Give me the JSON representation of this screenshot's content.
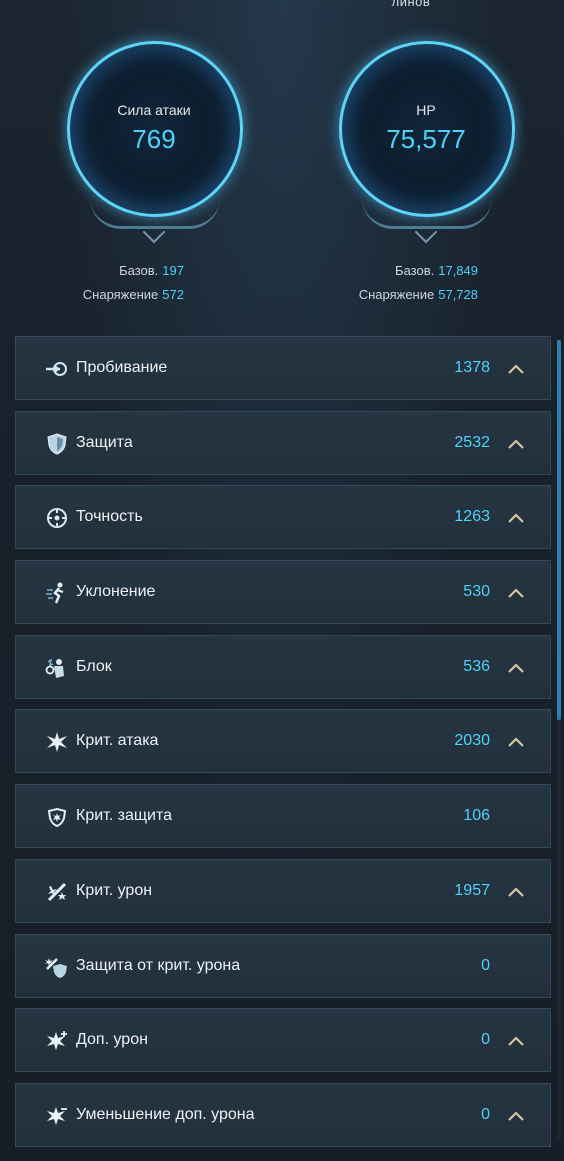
{
  "header": {
    "cut_text": "линов"
  },
  "attack": {
    "label": "Сила атаки",
    "value": "769",
    "base_label": "Базов.",
    "base_value": "197",
    "equip_label": "Снаряжение",
    "equip_value": "572"
  },
  "hp": {
    "label": "HP",
    "value": "75,577",
    "base_label": "Базов.",
    "base_value": "17,849",
    "equip_label": "Снаряжение",
    "equip_value": "57,728"
  },
  "stats": [
    {
      "label": "Пробивание",
      "value": "1378",
      "icon": "penetration-icon",
      "expandable": true
    },
    {
      "label": "Защита",
      "value": "2532",
      "icon": "shield-icon",
      "expandable": true
    },
    {
      "label": "Точность",
      "value": "1263",
      "icon": "crosshair-icon",
      "expandable": true
    },
    {
      "label": "Уклонение",
      "value": "530",
      "icon": "evade-icon",
      "expandable": true
    },
    {
      "label": "Блок",
      "value": "536",
      "icon": "block-icon",
      "expandable": true
    },
    {
      "label": "Крит. атака",
      "value": "2030",
      "icon": "crit-burst-icon",
      "expandable": true
    },
    {
      "label": "Крит. защита",
      "value": "106",
      "icon": "crit-defense-icon",
      "expandable": false
    },
    {
      "label": "Крит. урон",
      "value": "1957",
      "icon": "crit-damage-icon",
      "expandable": true
    },
    {
      "label": "Защита от крит. урона",
      "value": "0",
      "icon": "crit-damage-defense-icon",
      "expandable": false
    },
    {
      "label": "Доп. урон",
      "value": "0",
      "icon": "extra-damage-icon",
      "expandable": true
    },
    {
      "label": "Уменьшение доп. урона",
      "value": "0",
      "icon": "extra-damage-reduction-icon",
      "expandable": true
    }
  ],
  "colors": {
    "accent": "#4fd2f7",
    "ring": "#5fd3f5",
    "row_bg": "#243240",
    "chevron": "#d7c4a3"
  }
}
